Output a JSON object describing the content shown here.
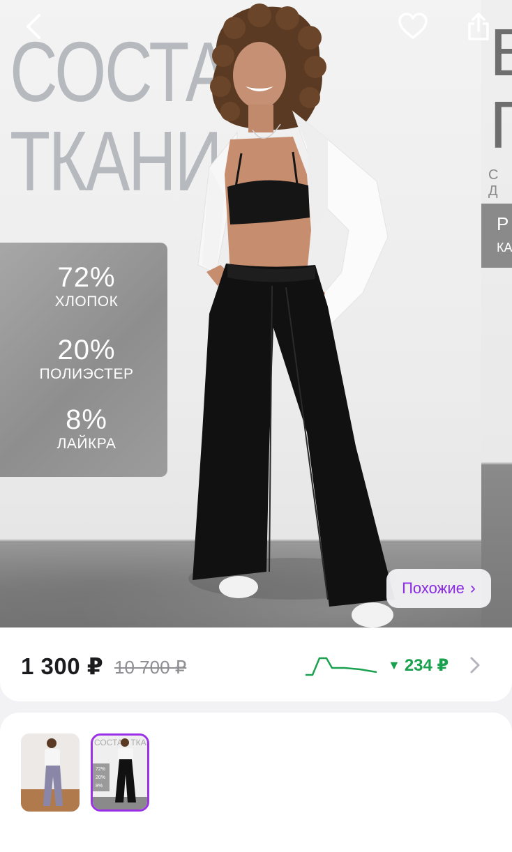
{
  "header": {
    "back_icon": "chevron-left-icon",
    "favorite_icon": "heart-icon",
    "share_icon": "share-icon"
  },
  "hero": {
    "headline_line1": "СОСТАВ",
    "headline_line2": "ТКАНИ",
    "composition": [
      {
        "percent": "72%",
        "material": "ХЛОПОК"
      },
      {
        "percent": "20%",
        "material": "ПОЛИЭСТЕР"
      },
      {
        "percent": "8%",
        "material": "ЛАЙКРА"
      }
    ],
    "next_slide": {
      "big_letters": [
        "В",
        "П"
      ],
      "small_text": "С Д",
      "box_letters": [
        "Р",
        "КА"
      ]
    },
    "similar_button": {
      "label": "Похожие",
      "chevron": "›"
    }
  },
  "price": {
    "current": "1 300 ₽",
    "old": "10 700 ₽",
    "drop_symbol": "▼",
    "drop_amount": "234 ₽",
    "colors": {
      "drop": "#1aa14f",
      "accent": "#8a2be2"
    }
  },
  "gallery": {
    "thumbnails": [
      {
        "name": "photo-1",
        "selected": false
      },
      {
        "name": "photo-2",
        "selected": true,
        "headline": "СОСТАВ ТКАНИ",
        "lines": [
          "72%",
          "20%",
          "8%"
        ]
      }
    ]
  }
}
